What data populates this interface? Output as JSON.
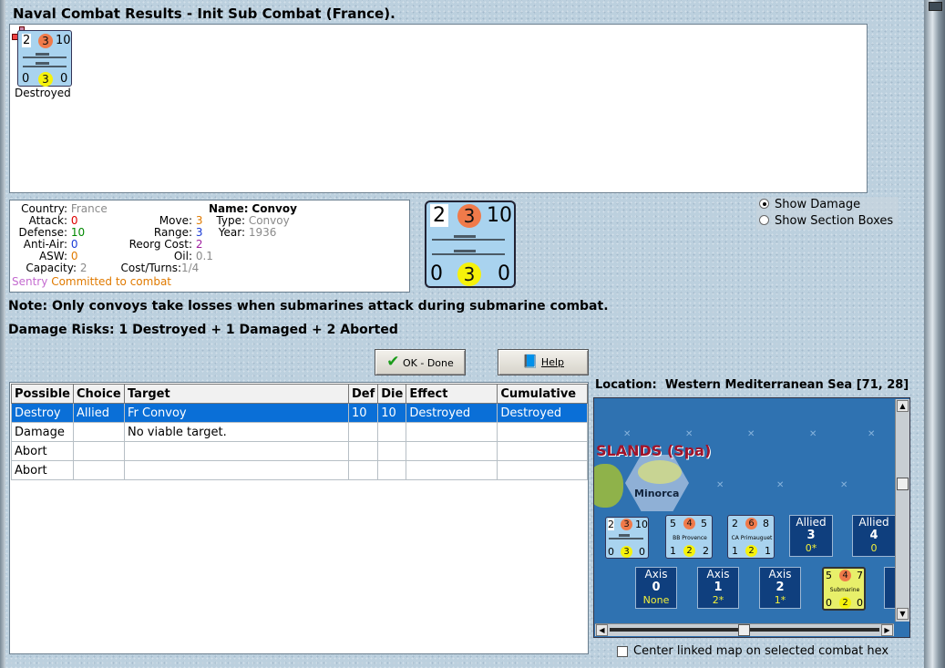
{
  "window": {
    "title": "Naval Combat Results - Init Sub Combat (France)."
  },
  "result_unit": {
    "top_left": "2",
    "circle": "3",
    "top_right": "10",
    "bottom_left": "0",
    "bottom_circle": "3",
    "bottom_right": "0",
    "status": "Destroyed"
  },
  "info": {
    "country_label": "Country:",
    "country": "France",
    "attack_label": "Attack:",
    "attack": "0",
    "defense_label": "Defense:",
    "defense": "10",
    "antiair_label": "Anti-Air:",
    "antiair": "0",
    "asw_label": "ASW:",
    "asw": "0",
    "capacity_label": "Capacity:",
    "capacity": "2",
    "move_label": "Move:",
    "move": "3",
    "range_label": "Range:",
    "range": "3",
    "reorg_label": "Reorg Cost:",
    "reorg": "2",
    "oil_label": "Oil:",
    "oil": "0.1",
    "costturns_label": "Cost/Turns:",
    "costturns": "1/4",
    "name_label": "Name:",
    "name": "Convoy",
    "type_label": "Type:",
    "type": "Convoy",
    "year_label": "Year:",
    "year": "1936",
    "status_prefix": "Sentry",
    "status_text": "Committed to combat"
  },
  "big_counter": {
    "top_left": "2",
    "circle": "3",
    "top_right": "10",
    "bottom_left": "0",
    "bottom_circle": "3",
    "bottom_right": "0"
  },
  "options": {
    "show_damage": "Show Damage",
    "show_sections": "Show Section Boxes"
  },
  "note": "Note: Only convoys take losses when submarines attack during submarine combat.",
  "damage_risks": "Damage Risks: 1 Destroyed + 1 Damaged + 2 Aborted",
  "buttons": {
    "ok": "OK - Done",
    "help": "Help"
  },
  "table": {
    "headers": [
      "Possible",
      "Choice",
      "Target",
      "Def",
      "Die",
      "Effect",
      "Cumulative"
    ],
    "rows": [
      [
        "Destroy",
        "Allied",
        "Fr Convoy",
        "10",
        "10",
        "Destroyed",
        "Destroyed"
      ],
      [
        "Damage",
        "",
        "No viable target.",
        "",
        "",
        "",
        ""
      ],
      [
        "Abort",
        "",
        "",
        "",
        "",
        "",
        ""
      ],
      [
        "Abort",
        "",
        "",
        "",
        "",
        "",
        ""
      ]
    ]
  },
  "location": {
    "label": "Location:",
    "value": "Western Mediterranean Sea [71, 28]"
  },
  "map": {
    "region_label": "SLANDS (Spa)",
    "island_label": "Minorca",
    "units": [
      {
        "tl": "2",
        "c": "3",
        "tr": "10",
        "bl": "0",
        "bc": "3",
        "br": "0",
        "name": ""
      },
      {
        "tl": "5",
        "c": "4",
        "tr": "5",
        "bl": "1",
        "bc": "2",
        "br": "2",
        "name": "BB Provence"
      },
      {
        "tl": "2",
        "c": "6",
        "tr": "8",
        "bl": "1",
        "bc": "2",
        "br": "1",
        "name": "CA Primauguet"
      },
      {
        "tl": "5",
        "c": "4",
        "tr": "7",
        "bl": "0",
        "bc": "2",
        "br": "0",
        "name": "Submarine"
      }
    ],
    "allied_boxes": [
      {
        "side": "Allied",
        "num": "3",
        "sub": "0*"
      },
      {
        "side": "Allied",
        "num": "4",
        "sub": "0"
      }
    ],
    "axis_boxes": [
      {
        "side": "Axis",
        "num": "0",
        "sub": "None"
      },
      {
        "side": "Axis",
        "num": "1",
        "sub": "2*"
      },
      {
        "side": "Axis",
        "num": "2",
        "sub": "1*"
      }
    ]
  },
  "center_map": "Center linked map on selected combat hex"
}
